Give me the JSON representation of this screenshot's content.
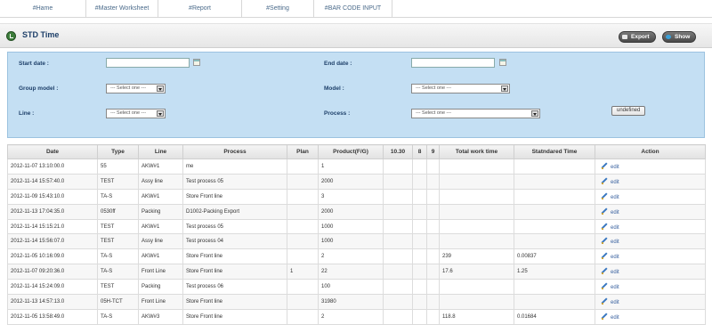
{
  "nav": {
    "tabs": [
      "#Hame",
      "#Master Worksheet",
      "#Report",
      "#Setting",
      "#BAR CODE INPUT"
    ]
  },
  "header": {
    "title": "STD Time",
    "export_label": "Export",
    "show_label": "Show"
  },
  "filters": {
    "start_date_label": "Start date :",
    "end_date_label": "End date :",
    "group_model_label": "Group model :",
    "model_label": "Model :",
    "line_label": "Line :",
    "process_label": "Process :",
    "select_placeholder": "--- Select one ---",
    "undefined_button": "undefined"
  },
  "table": {
    "columns": [
      "Date",
      "Type",
      "Line",
      "Process",
      "Plan",
      "Product(F/G)",
      "10.30",
      "8",
      "9",
      "Total work time",
      "Statndared Time",
      "Action"
    ],
    "edit_label": "edit",
    "rows": [
      [
        "2012-11-07 13:10:00.0",
        "55",
        "AKW#1",
        "me",
        "",
        "1",
        "",
        "",
        "",
        "",
        ""
      ],
      [
        "2012-11-14 15:57:40.0",
        "TEST",
        "Assy line",
        "Test process 05",
        "",
        "2000",
        "",
        "",
        "",
        "",
        ""
      ],
      [
        "2012-11-09 15:43:10.0",
        "TA-S",
        "AKW#1",
        "Store Front line",
        "",
        "3",
        "",
        "",
        "",
        "",
        ""
      ],
      [
        "2012-11-13 17:04:35.0",
        "0530ff",
        "Packing",
        "D1002-Packing Export",
        "",
        "2000",
        "",
        "",
        "",
        "",
        ""
      ],
      [
        "2012-11-14 15:15:21.0",
        "TEST",
        "AKW#1",
        "Test process 05",
        "",
        "1000",
        "",
        "",
        "",
        "",
        ""
      ],
      [
        "2012-11-14 15:56:07.0",
        "TEST",
        "Assy line",
        "Test process 04",
        "",
        "1000",
        "",
        "",
        "",
        "",
        ""
      ],
      [
        "2012-11-05 10:16:09.0",
        "TA-S",
        "AKW#1",
        "Store Front line",
        "",
        "2",
        "",
        "",
        "",
        "239",
        "0.00837"
      ],
      [
        "2012-11-07 09:20:36.0",
        "TA-S",
        "Front Line",
        "Store Front line",
        "1",
        "22",
        "",
        "",
        "",
        "17.6",
        "1.25"
      ],
      [
        "2012-11-14 15:24:09.0",
        "TEST",
        "Packing",
        "Test process 06",
        "",
        "100",
        "",
        "",
        "",
        "",
        ""
      ],
      [
        "2012-11-13 14:57:13.0",
        "05H-TCT",
        "Front Line",
        "Store Front line",
        "",
        "31980",
        "",
        "",
        "",
        "",
        ""
      ],
      [
        "2012-11-05 13:58:49.0",
        "TA-S",
        "AKW#3",
        "Store Front line",
        "",
        "2",
        "",
        "",
        "",
        "118.8",
        "0.01684"
      ]
    ]
  }
}
